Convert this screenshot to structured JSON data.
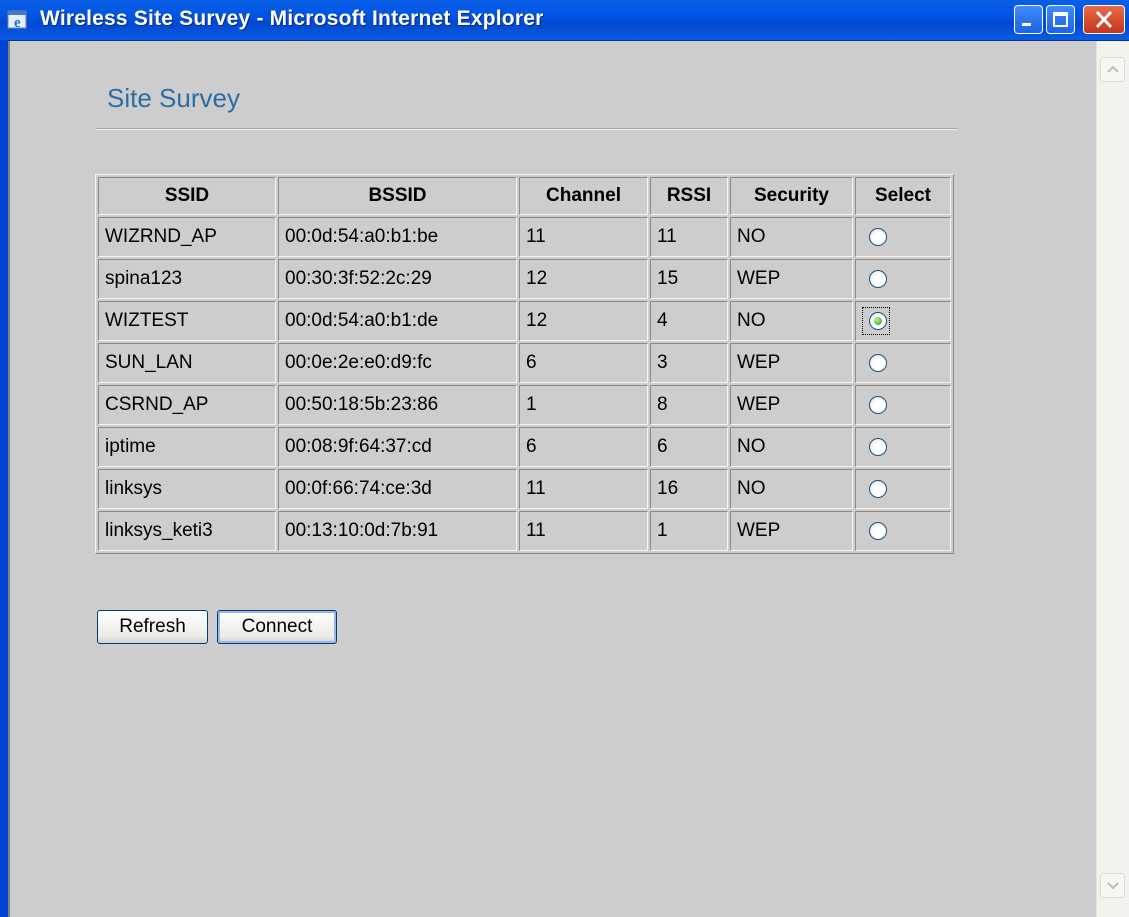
{
  "window": {
    "title": "Wireless Site Survey - Microsoft Internet Explorer"
  },
  "page": {
    "title": "Site Survey"
  },
  "table": {
    "headers": [
      "SSID",
      "BSSID",
      "Channel",
      "RSSI",
      "Security",
      "Select"
    ],
    "rows": [
      {
        "ssid": "WIZRND_AP",
        "bssid": "00:0d:54:a0:b1:be",
        "channel": "11",
        "rssi": "11",
        "security": "NO",
        "selected": false
      },
      {
        "ssid": "spina123",
        "bssid": "00:30:3f:52:2c:29",
        "channel": "12",
        "rssi": "15",
        "security": "WEP",
        "selected": false
      },
      {
        "ssid": "WIZTEST",
        "bssid": "00:0d:54:a0:b1:de",
        "channel": "12",
        "rssi": "4",
        "security": "NO",
        "selected": true
      },
      {
        "ssid": "SUN_LAN",
        "bssid": "00:0e:2e:e0:d9:fc",
        "channel": "6",
        "rssi": "3",
        "security": "WEP",
        "selected": false
      },
      {
        "ssid": "CSRND_AP",
        "bssid": "00:50:18:5b:23:86",
        "channel": "1",
        "rssi": "8",
        "security": "WEP",
        "selected": false
      },
      {
        "ssid": "iptime",
        "bssid": "00:08:9f:64:37:cd",
        "channel": "6",
        "rssi": "6",
        "security": "NO",
        "selected": false
      },
      {
        "ssid": "linksys",
        "bssid": "00:0f:66:74:ce:3d",
        "channel": "11",
        "rssi": "16",
        "security": "NO",
        "selected": false
      },
      {
        "ssid": "linksys_keti3",
        "bssid": "00:13:10:0d:7b:91",
        "channel": "11",
        "rssi": "1",
        "security": "WEP",
        "selected": false
      }
    ]
  },
  "buttons": {
    "refresh": "Refresh",
    "connect": "Connect"
  },
  "icons": {
    "window": "ie-icon",
    "minimize": "minimize-icon",
    "maximize": "maximize-icon",
    "close": "close-icon"
  },
  "colors": {
    "titlebar": "#0053e3",
    "page_title": "#2a6ea8",
    "background": "#cdcdcd",
    "close_button": "#d04a2a"
  }
}
